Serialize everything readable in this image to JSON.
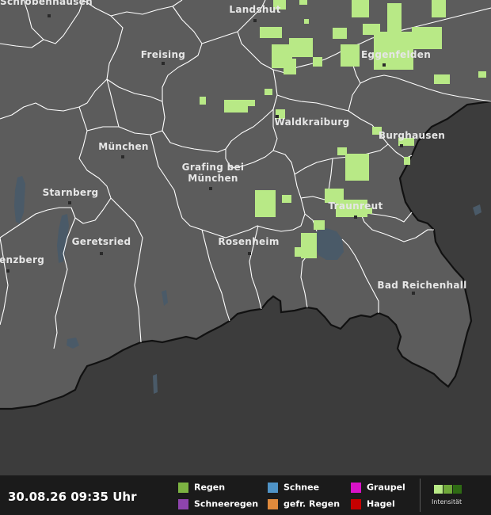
{
  "map": {
    "cities": [
      {
        "id": "schrobenhausen",
        "name": "Schrobenhausen"
      },
      {
        "id": "landshut",
        "name": "Landshut"
      },
      {
        "id": "freising",
        "name": "Freising"
      },
      {
        "id": "eggenfelden",
        "name": "Eggenfelden"
      },
      {
        "id": "waldkraiburg",
        "name": "Waldkraiburg"
      },
      {
        "id": "muenchen",
        "name": "München"
      },
      {
        "id": "burghausen",
        "name": "Burghausen"
      },
      {
        "id": "grafing-line1",
        "name": "Grafing bei"
      },
      {
        "id": "grafing-line2",
        "name": "München"
      },
      {
        "id": "starnberg",
        "name": "Starnberg"
      },
      {
        "id": "traunreut",
        "name": "Traunreut"
      },
      {
        "id": "geretsried",
        "name": "Geretsried"
      },
      {
        "id": "rosenheim",
        "name": "Rosenheim"
      },
      {
        "id": "penzberg",
        "name": "Penzberg"
      },
      {
        "id": "bad-reichenhall",
        "name": "Bad Reichenhall"
      }
    ],
    "colors": {
      "land": "#5c5c5c",
      "outside": "#3c3c3c",
      "district_border": "#ffffff",
      "country_border": "#111111",
      "water": "#4a5a68",
      "rain_light": "#b8e986"
    }
  },
  "footer": {
    "timestamp": "30.08.26 09:35 Uhr",
    "legend": [
      {
        "id": "regen",
        "label": "Regen",
        "color": "#7cb342"
      },
      {
        "id": "schneeregen",
        "label": "Schneeregen",
        "color": "#8e44ad"
      },
      {
        "id": "schnee",
        "label": "Schnee",
        "color": "#4f93c6"
      },
      {
        "id": "gefr-regen",
        "label": "gefr. Regen",
        "color": "#e08a3c"
      },
      {
        "id": "graupel",
        "label": "Graupel",
        "color": "#d812c8"
      },
      {
        "id": "hagel",
        "label": "Hagel",
        "color": "#c60000"
      }
    ],
    "intensity": {
      "label": "Intensität",
      "colors": [
        "#b8e986",
        "#6fa83a",
        "#2f6b14"
      ]
    }
  }
}
